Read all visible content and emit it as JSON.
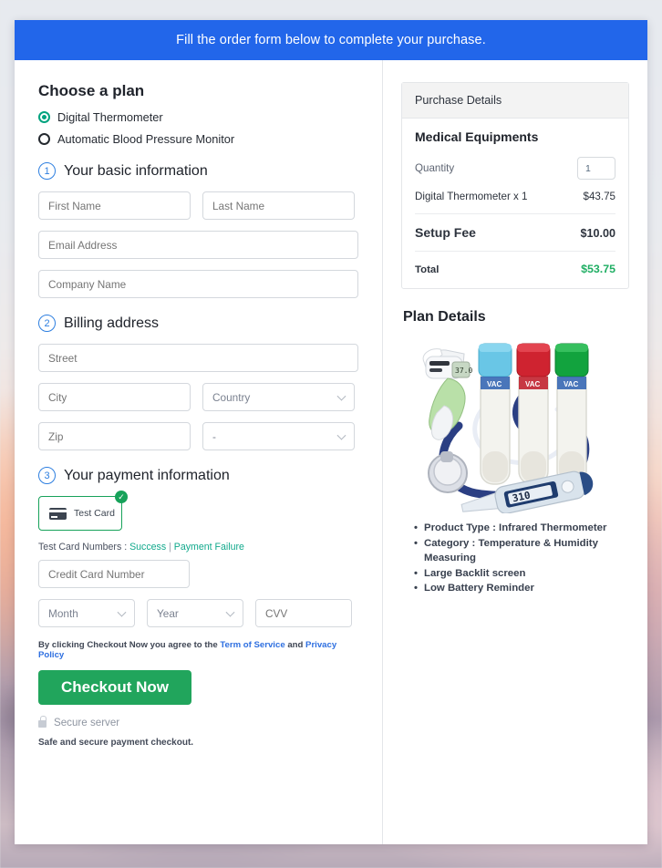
{
  "banner": {
    "text": "Fill the order form below to complete your purchase."
  },
  "plan": {
    "heading": "Choose a plan",
    "options": [
      {
        "label": "Digital Thermometer",
        "selected": true
      },
      {
        "label": "Automatic Blood Pressure Monitor",
        "selected": false
      }
    ]
  },
  "steps": {
    "basic": {
      "number": "1",
      "title": "Your basic information"
    },
    "billing": {
      "number": "2",
      "title": "Billing address"
    },
    "payment": {
      "number": "3",
      "title": "Your payment information"
    }
  },
  "fields": {
    "first_name": {
      "placeholder": "First Name",
      "value": ""
    },
    "last_name": {
      "placeholder": "Last Name",
      "value": ""
    },
    "email": {
      "placeholder": "Email Address",
      "value": ""
    },
    "company": {
      "placeholder": "Company Name",
      "value": ""
    },
    "street": {
      "placeholder": "Street",
      "value": ""
    },
    "city": {
      "placeholder": "City",
      "value": ""
    },
    "country": {
      "selected": "Country"
    },
    "zip": {
      "placeholder": "Zip",
      "value": ""
    },
    "state": {
      "selected": "-"
    },
    "credit_card": {
      "placeholder": "Credit Card Number",
      "value": ""
    },
    "month": {
      "selected": "Month"
    },
    "year": {
      "selected": "Year"
    },
    "cvv": {
      "placeholder": "CVV",
      "value": ""
    }
  },
  "payment": {
    "card_tile_label": "Test  Card",
    "card_tile_badge": "✓",
    "test_numbers_prefix": "Test Card Numbers : ",
    "test_success_link": "Success",
    "test_separator": " | ",
    "test_failure_link": "Payment Failure"
  },
  "terms": {
    "prefix": "By clicking Checkout Now you agree to the ",
    "tos_link": "Term of Service",
    "middle": " and ",
    "privacy_link": "Privacy Policy"
  },
  "checkout": {
    "label": "Checkout Now"
  },
  "secure": {
    "server_text": "Secure server",
    "safe_text": "Safe and secure payment checkout."
  },
  "purchase": {
    "header": "Purchase Details",
    "equipment_title": "Medical Equipments",
    "quantity_label": "Quantity",
    "quantity_value": "1",
    "item_label": "Digital Thermometer x 1",
    "item_price": "$43.75",
    "setup_label": "Setup Fee",
    "setup_price": "$10.00",
    "total_label": "Total",
    "total_price": "$53.75"
  },
  "plan_details": {
    "title": "Plan Details",
    "bullets": [
      "Product Type : Infrared Thermometer",
      "Category : Temperature & Humidity Measuring",
      "Large Backlit screen",
      "Low Battery Reminder"
    ]
  },
  "colors": {
    "banner_blue": "#2266ea",
    "checkout_green": "#21a55c",
    "total_green": "#1fae63",
    "radio_teal": "#02a37f",
    "step_blue": "#2e7fe0",
    "link_blue": "#2e6fe0",
    "link_teal": "#11a98c"
  }
}
